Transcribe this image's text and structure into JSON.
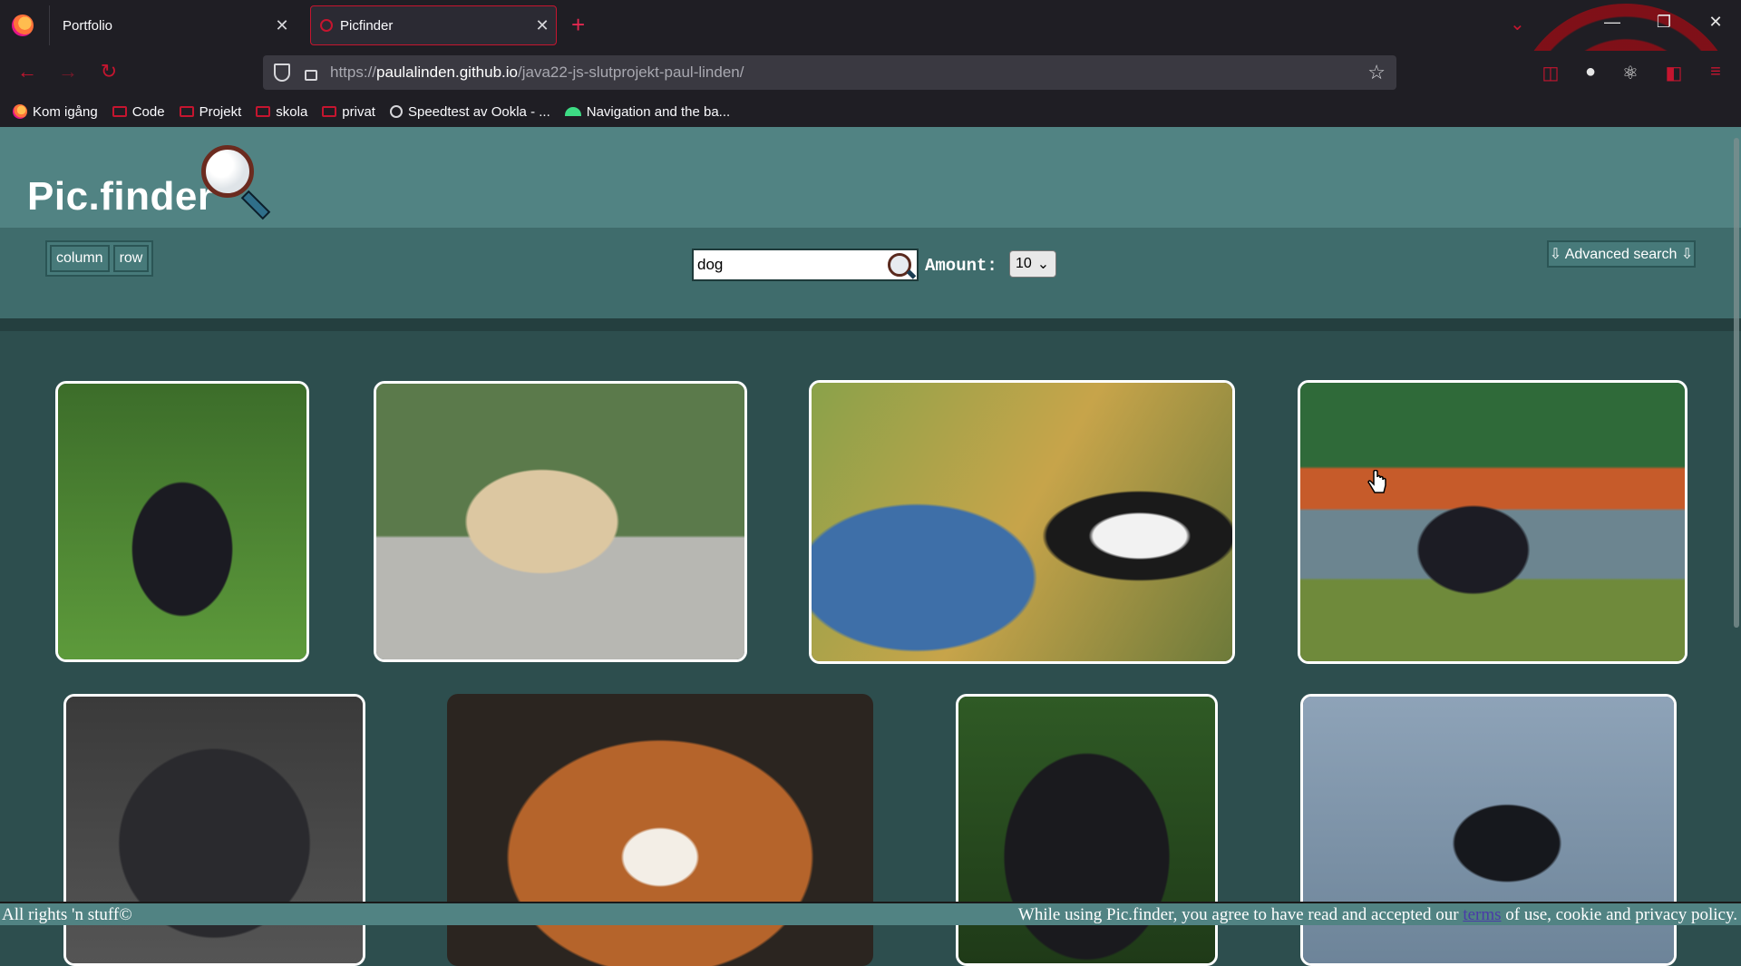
{
  "browser": {
    "tabs": [
      {
        "label": "Portfolio",
        "active": false
      },
      {
        "label": "Picfinder",
        "active": true
      }
    ],
    "url": {
      "prefix": "https://",
      "domain": "paulalinden.github.io",
      "path": "/java22-js-slutprojekt-paul-linden/"
    },
    "bookmarks": [
      {
        "label": "Kom igång",
        "icon": "firefox-icon"
      },
      {
        "label": "Code",
        "icon": "folder-icon"
      },
      {
        "label": "Projekt",
        "icon": "folder-icon"
      },
      {
        "label": "skola",
        "icon": "folder-icon"
      },
      {
        "label": "privat",
        "icon": "folder-icon"
      },
      {
        "label": "Speedtest av Ookla - ...",
        "icon": "speedtest-icon"
      },
      {
        "label": "Navigation and the ba...",
        "icon": "android-icon"
      }
    ],
    "accent_color": "#c5152f"
  },
  "app": {
    "logo_text": "Pic.finder",
    "view_buttons": {
      "column": "column",
      "row": "row"
    },
    "search": {
      "value": "dog"
    },
    "amount": {
      "label": "Amount:",
      "value": "10"
    },
    "advanced_search": "⇩ Advanced search ⇩",
    "colors": {
      "header": "#518383",
      "controls": "#3f6c6c",
      "gallery_bg": "#2d4e4e"
    }
  },
  "gallery": [
    {
      "alt": "black schnauzer with red and green scarf on grass"
    },
    {
      "alt": "cream doodle on leash on sidewalk"
    },
    {
      "alt": "man in cap with border collie on lap"
    },
    {
      "alt": "black giant schnauzer with orange bandana by lake"
    },
    {
      "alt": "black schnauzer with pink bandana close-up"
    },
    {
      "alt": "brown and white dog face close-up"
    },
    {
      "alt": "black scottish terrier portrait"
    },
    {
      "alt": "black dog leaping into water"
    }
  ],
  "footer": {
    "left": "All rights 'n stuff©",
    "right_prefix": "While using Pic.finder, you agree to have read and accepted our",
    "right_link": "terms",
    "right_suffix": "of use, cookie and privacy policy."
  }
}
